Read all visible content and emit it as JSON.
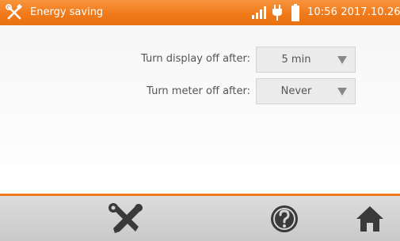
{
  "header": {
    "title": "Energy saving",
    "datetime": "10:56 2017.10.26"
  },
  "settings": [
    {
      "label": "Turn display off after:",
      "value": "5 min"
    },
    {
      "label": "Turn meter off after:",
      "value": "Never"
    }
  ],
  "footer": {
    "buttons": [
      "tools-icon",
      "help-icon",
      "home-icon"
    ]
  },
  "colors": {
    "accent": "#f07a1b",
    "text": "#555555",
    "footer": "#cfcfcf"
  },
  "icons": {
    "header": [
      "tools-icon",
      "signal-icon",
      "plug-icon",
      "battery-icon"
    ]
  }
}
